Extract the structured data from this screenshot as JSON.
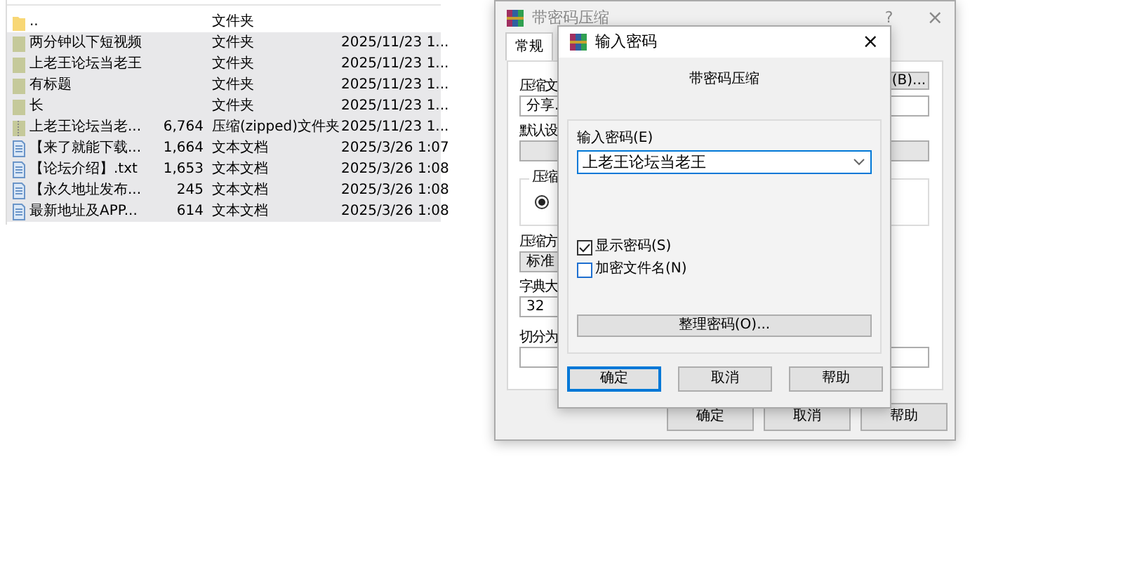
{
  "file_list": {
    "rows": [
      {
        "kind": "parent",
        "name": "..",
        "type": "文件夹",
        "selected": false
      },
      {
        "kind": "folder",
        "name": "两分钟以下短视频",
        "type": "文件夹",
        "modified": "2025/11/23 1...",
        "selected": true
      },
      {
        "kind": "folder",
        "name": "上老王论坛当老王",
        "type": "文件夹",
        "modified": "2025/11/23 1...",
        "selected": true
      },
      {
        "kind": "folder",
        "name": "有标题",
        "type": "文件夹",
        "modified": "2025/11/23 1...",
        "selected": true
      },
      {
        "kind": "folder",
        "name": "长",
        "type": "文件夹",
        "modified": "2025/11/23 1...",
        "selected": true
      },
      {
        "kind": "zip",
        "name": "上老王论坛当老...",
        "size": "6,764",
        "type": "压缩(zipped)文件夹",
        "modified": "2025/11/23 1...",
        "selected": true
      },
      {
        "kind": "text",
        "name": "【来了就能下载...",
        "size": "1,664",
        "type": "文本文档",
        "modified": "2025/3/26 1:07",
        "selected": true
      },
      {
        "kind": "text",
        "name": "【论坛介绍】.txt",
        "size": "1,653",
        "type": "文本文档",
        "modified": "2025/3/26 1:08",
        "selected": true
      },
      {
        "kind": "text",
        "name": "【永久地址发布...",
        "size": "245",
        "type": "文本文档",
        "modified": "2025/3/26 1:08",
        "selected": true
      },
      {
        "kind": "text",
        "name": "最新地址及APP...",
        "size": "614",
        "type": "文本文档",
        "modified": "2025/3/26 1:08",
        "selected": true
      }
    ]
  },
  "archive_dialog": {
    "title": "带密码压缩",
    "help": "?",
    "close": "×",
    "tabs": [
      {
        "label": "常规",
        "selected": true
      }
    ],
    "archive_name_label": "压缩文",
    "browse_button": "(B)...",
    "archive_name_value": "分享.",
    "profile_label": "默认设",
    "group_label": "压缩",
    "radio_checked": true,
    "method_label": "压缩方",
    "method_value": "标准",
    "dictionary_label": "字典大",
    "dictionary_value": "32",
    "split_label": "切分为",
    "buttons": [
      "确定",
      "取消",
      "帮助"
    ]
  },
  "password_dialog": {
    "title": "输入密码",
    "close": "×",
    "heading": "带密码压缩",
    "password_label": "输入密码(E)",
    "password_value": "上老王论坛当老王",
    "options": [
      {
        "label": "显示密码(S)",
        "checked": true
      },
      {
        "label": "加密文件名(N)",
        "checked": false
      }
    ],
    "organize_button": "整理密码(O)...",
    "buttons": [
      {
        "label": "确定",
        "selected": true
      },
      {
        "label": "取消",
        "selected": false
      },
      {
        "label": "帮助",
        "selected": false
      }
    ]
  }
}
